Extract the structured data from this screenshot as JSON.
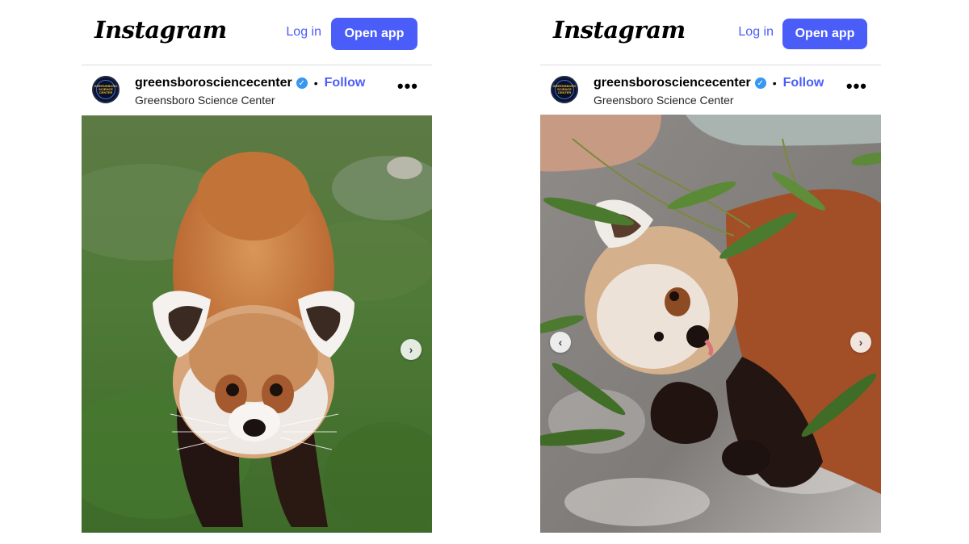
{
  "posts": [
    {
      "logo": "Instagram",
      "login_label": "Log in",
      "open_app_label": "Open app",
      "username": "greensborosciencecenter",
      "separator": "•",
      "follow_label": "Follow",
      "location": "Greensboro Science Center",
      "more_label": "•••",
      "avatar_text": [
        "GREENSBORO",
        "SCIENCE",
        "CENTER"
      ],
      "photo_alt": "red panda walking on grass",
      "nav_next": "›"
    },
    {
      "logo": "Instagram",
      "login_label": "Log in",
      "open_app_label": "Open app",
      "username": "greensborosciencecenter",
      "separator": "•",
      "follow_label": "Follow",
      "location": "Greensboro Science Center",
      "more_label": "•••",
      "avatar_text": [
        "GREENSBORO",
        "SCIENCE",
        "CENTER"
      ],
      "photo_alt": "red panda cub lying with bamboo leaves",
      "nav_prev": "‹",
      "nav_next": "›"
    }
  ],
  "colors": {
    "accent": "#4a5df9",
    "verified": "#3897f0",
    "border": "#dbdbdb"
  }
}
